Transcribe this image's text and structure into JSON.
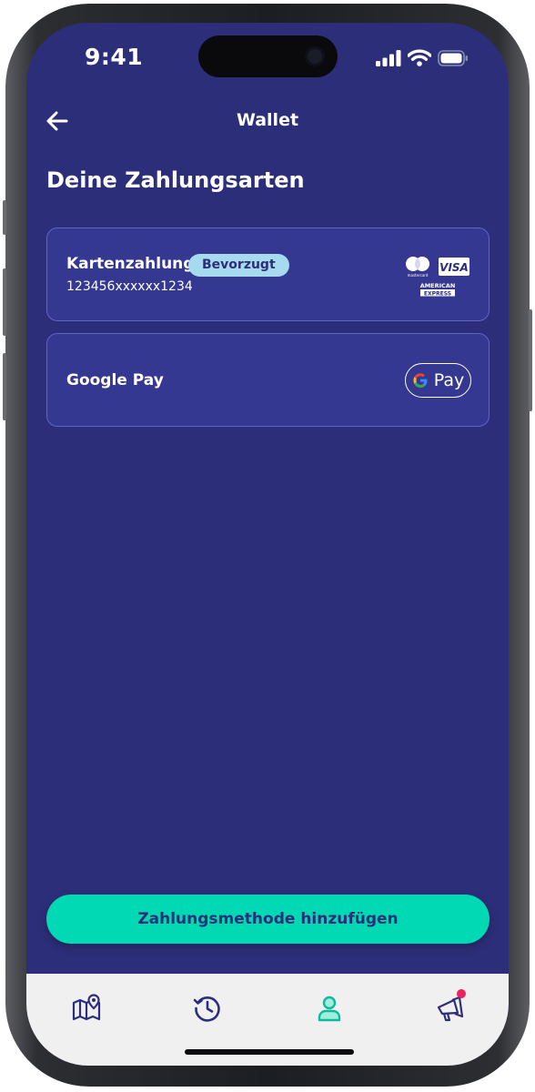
{
  "status_bar": {
    "time": "9:41"
  },
  "nav": {
    "title": "Wallet"
  },
  "page": {
    "heading": "Deine Zahlungsarten"
  },
  "payment_methods": [
    {
      "label": "Kartenzahlung",
      "badge": "Bevorzugt",
      "card_number": "123456xxxxxx1234",
      "brand_icons": [
        "mastercard-icon",
        "visa-icon",
        "american-express-icon"
      ],
      "brand_text": {
        "mastercard": "mastercard",
        "visa": "VISA",
        "amex_line1": "AMERICAN",
        "amex_line2": "EXPRESS"
      }
    },
    {
      "label": "Google Pay",
      "pill_text": "Pay",
      "brand_icons": [
        "google-g-icon"
      ]
    }
  ],
  "primary_action": {
    "label": "Zahlungsmethode hinzufügen"
  },
  "tab_bar": {
    "tabs": [
      {
        "icon": "map-pin-icon",
        "active": false
      },
      {
        "icon": "history-icon",
        "active": false
      },
      {
        "icon": "profile-icon",
        "active": true
      },
      {
        "icon": "megaphone-icon",
        "active": false,
        "notification": true
      }
    ]
  },
  "colors": {
    "background": "#2d2e79",
    "card": "#353891",
    "card_border": "#5f64c7",
    "accent": "#01d9b5",
    "badge_bg": "#a6dbef",
    "tab_bar": "#f0f0f1",
    "notification": "#f0205b"
  }
}
